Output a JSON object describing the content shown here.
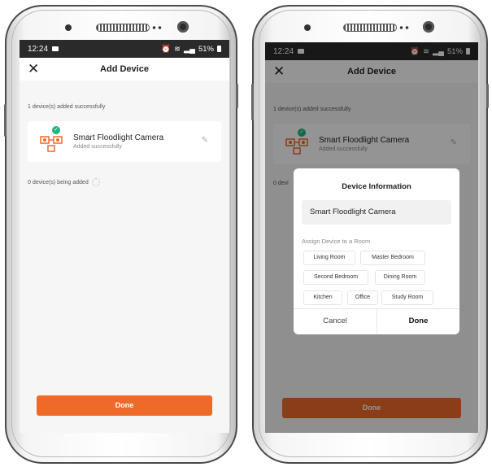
{
  "status_bar": {
    "time": "12:24",
    "battery": "51%"
  },
  "header": {
    "close_glyph": "✕",
    "title": "Add Device"
  },
  "added_note": "1 device(s) added successfully",
  "device": {
    "name": "Smart Floodlight Camera",
    "status": "Added successfully",
    "check_glyph": "✓",
    "edit_glyph": "✎"
  },
  "adding_note": "0 device(s) being added",
  "adding_note_truncated": "0 devi",
  "done_label": "Done",
  "dialog": {
    "title": "Device Information",
    "name_value": "Smart Floodlight Camera",
    "assign_label": "Assign Device to a Room",
    "rooms": [
      "Living Room",
      "Master Bedroom",
      "Second Bedroom",
      "Dining Room",
      "Kitchen",
      "Office",
      "Study Room"
    ],
    "cancel_label": "Cancel",
    "done_label": "Done"
  },
  "colors": {
    "accent": "#ef6a2a",
    "success": "#1fb57f",
    "statusbar": "#2a2a2a"
  },
  "icons": [
    "close-icon",
    "camera-device-icon",
    "check-icon",
    "edit-icon",
    "wifi-icon",
    "signal-icon",
    "battery-icon",
    "alarm-icon",
    "message-icon",
    "loading-spinner-icon"
  ]
}
